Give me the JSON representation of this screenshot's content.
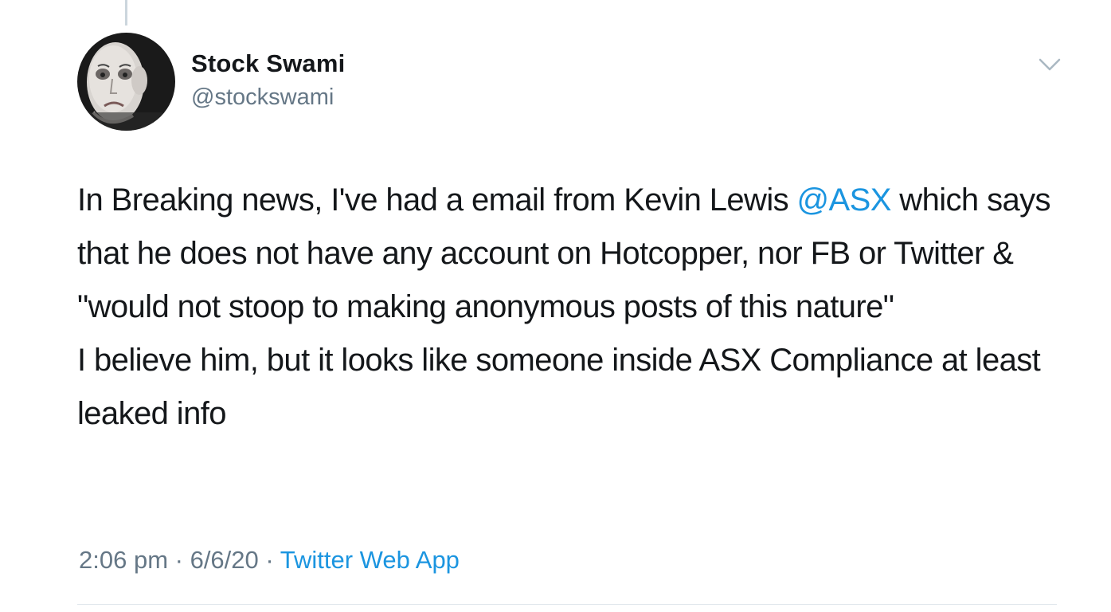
{
  "author": {
    "display_name": "Stock Swami",
    "handle": "@stockswami",
    "avatar_icon": "profile-photo"
  },
  "tweet": {
    "paragraph1_part1": "In Breaking news, I've had a email from Kevin Lewis ",
    "mention": "@ASX",
    "paragraph1_part2": " which says that he does not have any account on Hotcopper, nor FB or Twitter & \"would not stoop to making anonymous posts of this nature\"",
    "paragraph2": "I believe him, but it looks like someone inside ASX Compliance at least leaked info"
  },
  "meta": {
    "time": "2:06 pm",
    "separator": " · ",
    "date": "6/6/20",
    "source": "Twitter Web App"
  },
  "colors": {
    "link": "#1b95e0",
    "secondary_text": "#657786",
    "primary_text": "#14171a",
    "divider": "#e1e8ed"
  }
}
